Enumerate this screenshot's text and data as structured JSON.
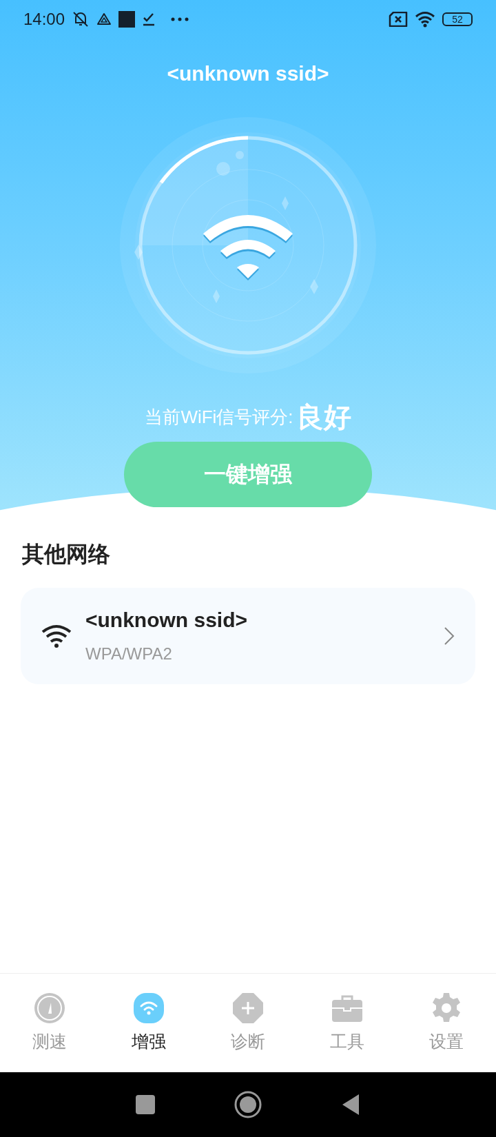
{
  "status_bar": {
    "time": "14:00",
    "battery": "52"
  },
  "title": "<unknown ssid>",
  "rating": {
    "label": "当前WiFi信号评分:",
    "value": "良好"
  },
  "boost_button": "一键增强",
  "section_title": "其他网络",
  "networks": [
    {
      "name": "<unknown ssid>",
      "security": "WPA/WPA2"
    }
  ],
  "nav": [
    {
      "label": "测速",
      "kind": "speed",
      "selected": false
    },
    {
      "label": "增强",
      "kind": "boost",
      "selected": true
    },
    {
      "label": "诊断",
      "kind": "diagnose",
      "selected": false
    },
    {
      "label": "工具",
      "kind": "tools",
      "selected": false
    },
    {
      "label": "设置",
      "kind": "settings",
      "selected": false
    }
  ]
}
